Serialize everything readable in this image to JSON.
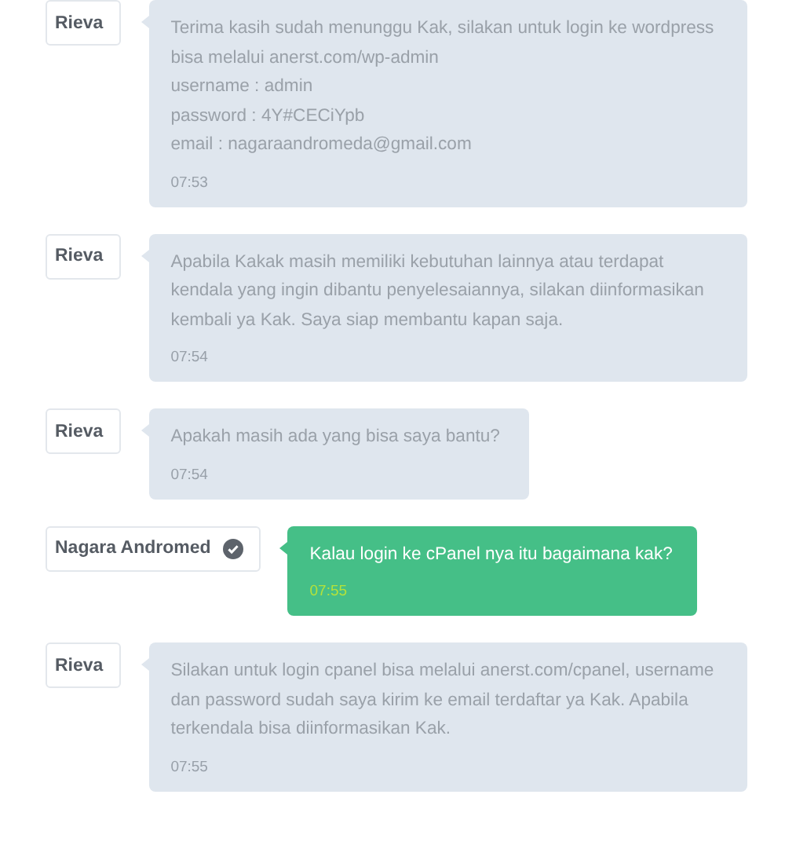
{
  "messages": [
    {
      "kind": "agent",
      "sender": "Rieva",
      "verified": false,
      "text": "Terima kasih sudah menunggu Kak, silakan untuk login ke wordpress bisa melalui anerst.com/wp-admin\nusername : admin\npassword : 4Y#CECiYpb\nemail : nagaraandromeda@gmail.com",
      "time": "07:53"
    },
    {
      "kind": "agent",
      "sender": "Rieva",
      "verified": false,
      "text": "Apabila Kakak masih memiliki kebutuhan lainnya atau terdapat kendala yang ingin dibantu penyelesaiannya, silakan diinformasikan kembali ya Kak. Saya siap membantu kapan saja.",
      "time": "07:54"
    },
    {
      "kind": "agent",
      "sender": "Rieva",
      "verified": false,
      "text": "Apakah masih ada yang bisa saya bantu?",
      "time": "07:54"
    },
    {
      "kind": "customer",
      "sender": "Nagara Andromed",
      "verified": true,
      "text": "Kalau login ke cPanel nya itu bagaimana kak?",
      "time": "07:55"
    },
    {
      "kind": "agent",
      "sender": "Rieva",
      "verified": false,
      "text": "Silakan untuk login cpanel bisa melalui anerst.com/cpanel, username dan password sudah saya kirim ke email terdaftar ya Kak. Apabila terkendala bisa diinformasikan Kak.",
      "time": "07:55"
    }
  ]
}
